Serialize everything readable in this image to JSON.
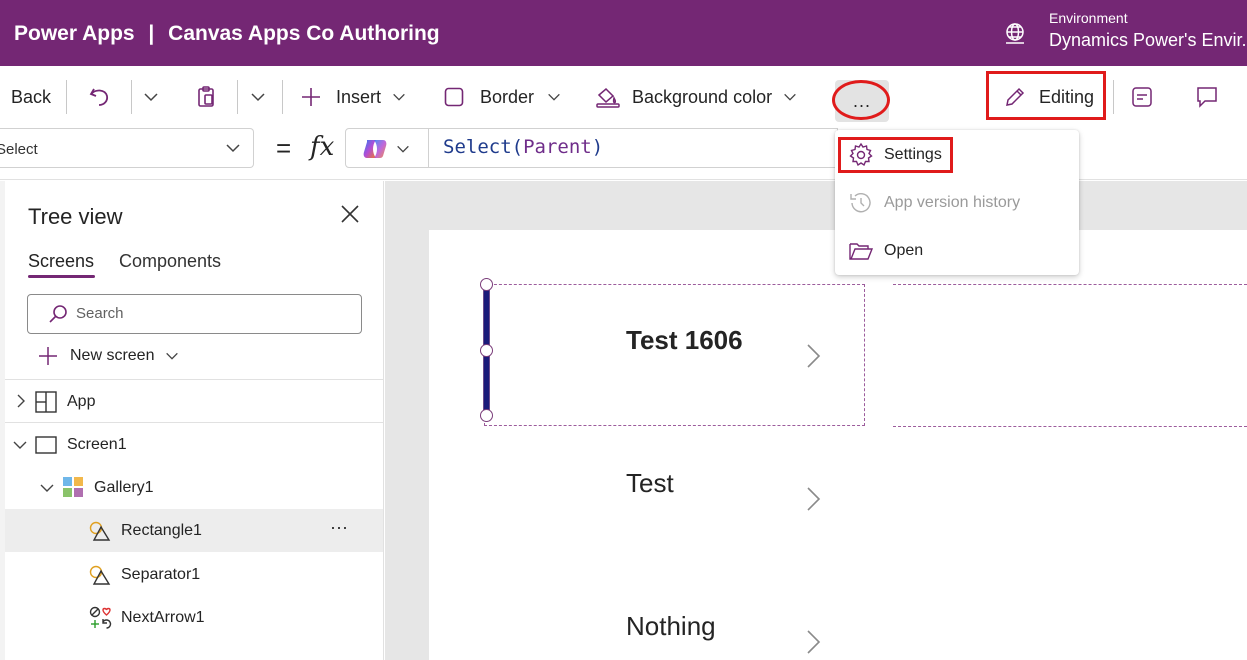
{
  "titlebar": {
    "app_name": "Power Apps",
    "separator": "|",
    "subtitle": "Canvas Apps Co Authoring",
    "environment_label": "Environment",
    "environment_value": "Dynamics Power's Envir..."
  },
  "commandbar": {
    "back": "Back",
    "insert": "Insert",
    "border": "Border",
    "background_color": "Background color",
    "more": "...",
    "editing": "Editing"
  },
  "formulabar": {
    "property": "Select",
    "equals": "=",
    "fx": "fx",
    "formula_fn": "Select",
    "formula_open": "(",
    "formula_arg": "Parent",
    "formula_close": ")"
  },
  "treeview": {
    "title": "Tree view",
    "tabs": [
      "Screens",
      "Components"
    ],
    "search_placeholder": "Search",
    "new_screen": "New screen",
    "items": [
      {
        "label": "App"
      },
      {
        "label": "Screen1"
      },
      {
        "label": "Gallery1"
      },
      {
        "label": "Rectangle1",
        "more": "···"
      },
      {
        "label": "Separator1"
      },
      {
        "label": "NextArrow1"
      }
    ]
  },
  "gallery": {
    "items": [
      "Test 1606",
      "Test",
      "Nothing"
    ]
  },
  "menu": {
    "items": [
      {
        "label": "Settings"
      },
      {
        "label": "App version history"
      },
      {
        "label": "Open"
      }
    ]
  },
  "colors": {
    "brand": "#742774",
    "highlight": "#e01b1b"
  }
}
